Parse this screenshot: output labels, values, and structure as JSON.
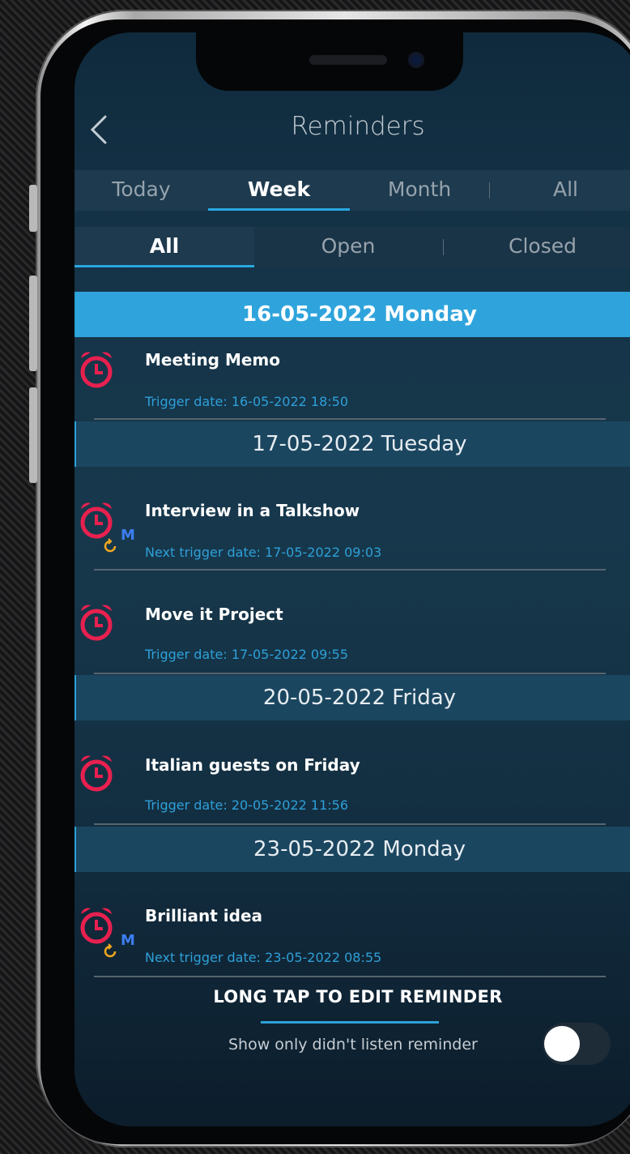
{
  "header": {
    "title": "Reminders"
  },
  "tabs": [
    {
      "label": "Today",
      "active": false
    },
    {
      "label": "Week",
      "active": true
    },
    {
      "label": "Month",
      "active": false
    },
    {
      "label": "All",
      "active": false
    }
  ],
  "subtabs": [
    {
      "label": "All",
      "active": true
    },
    {
      "label": "Open",
      "active": false
    },
    {
      "label": "Closed",
      "active": false
    }
  ],
  "groups": [
    {
      "date": "16-05-2022 Monday",
      "highlighted": true,
      "items": [
        {
          "title": "Meeting Memo",
          "trigger": "Trigger date: 16-05-2022 18:50",
          "repeating": false
        }
      ]
    },
    {
      "date": "17-05-2022 Tuesday",
      "highlighted": false,
      "items": [
        {
          "title": "Interview in a Talkshow",
          "trigger": "Next trigger date: 17-05-2022 09:03",
          "repeating": true,
          "badge": "M"
        },
        {
          "title": "Move it Project",
          "trigger": "Trigger date: 17-05-2022 09:55",
          "repeating": false
        }
      ]
    },
    {
      "date": "20-05-2022 Friday",
      "highlighted": false,
      "items": [
        {
          "title": "Italian guests on Friday",
          "trigger": "Trigger date: 20-05-2022 11:56",
          "repeating": false
        }
      ]
    },
    {
      "date": "23-05-2022 Monday",
      "highlighted": false,
      "items": [
        {
          "title": "Brilliant idea",
          "trigger": "Next trigger date: 23-05-2022 08:55",
          "repeating": true,
          "badge": "M"
        }
      ]
    }
  ],
  "footer": {
    "hint": "LONG TAP TO EDIT REMINDER",
    "toggle_label": "Show only didn't listen reminder",
    "toggle_on": false
  },
  "icons": {
    "back": "chevron-left-icon",
    "alarm": "alarm-clock-icon",
    "repeat": "repeat-icon"
  },
  "colors": {
    "accent": "#2ea0d8",
    "alarm": "#e8204f",
    "repeat": "#f0a71e",
    "badge": "#3d7ef2"
  }
}
